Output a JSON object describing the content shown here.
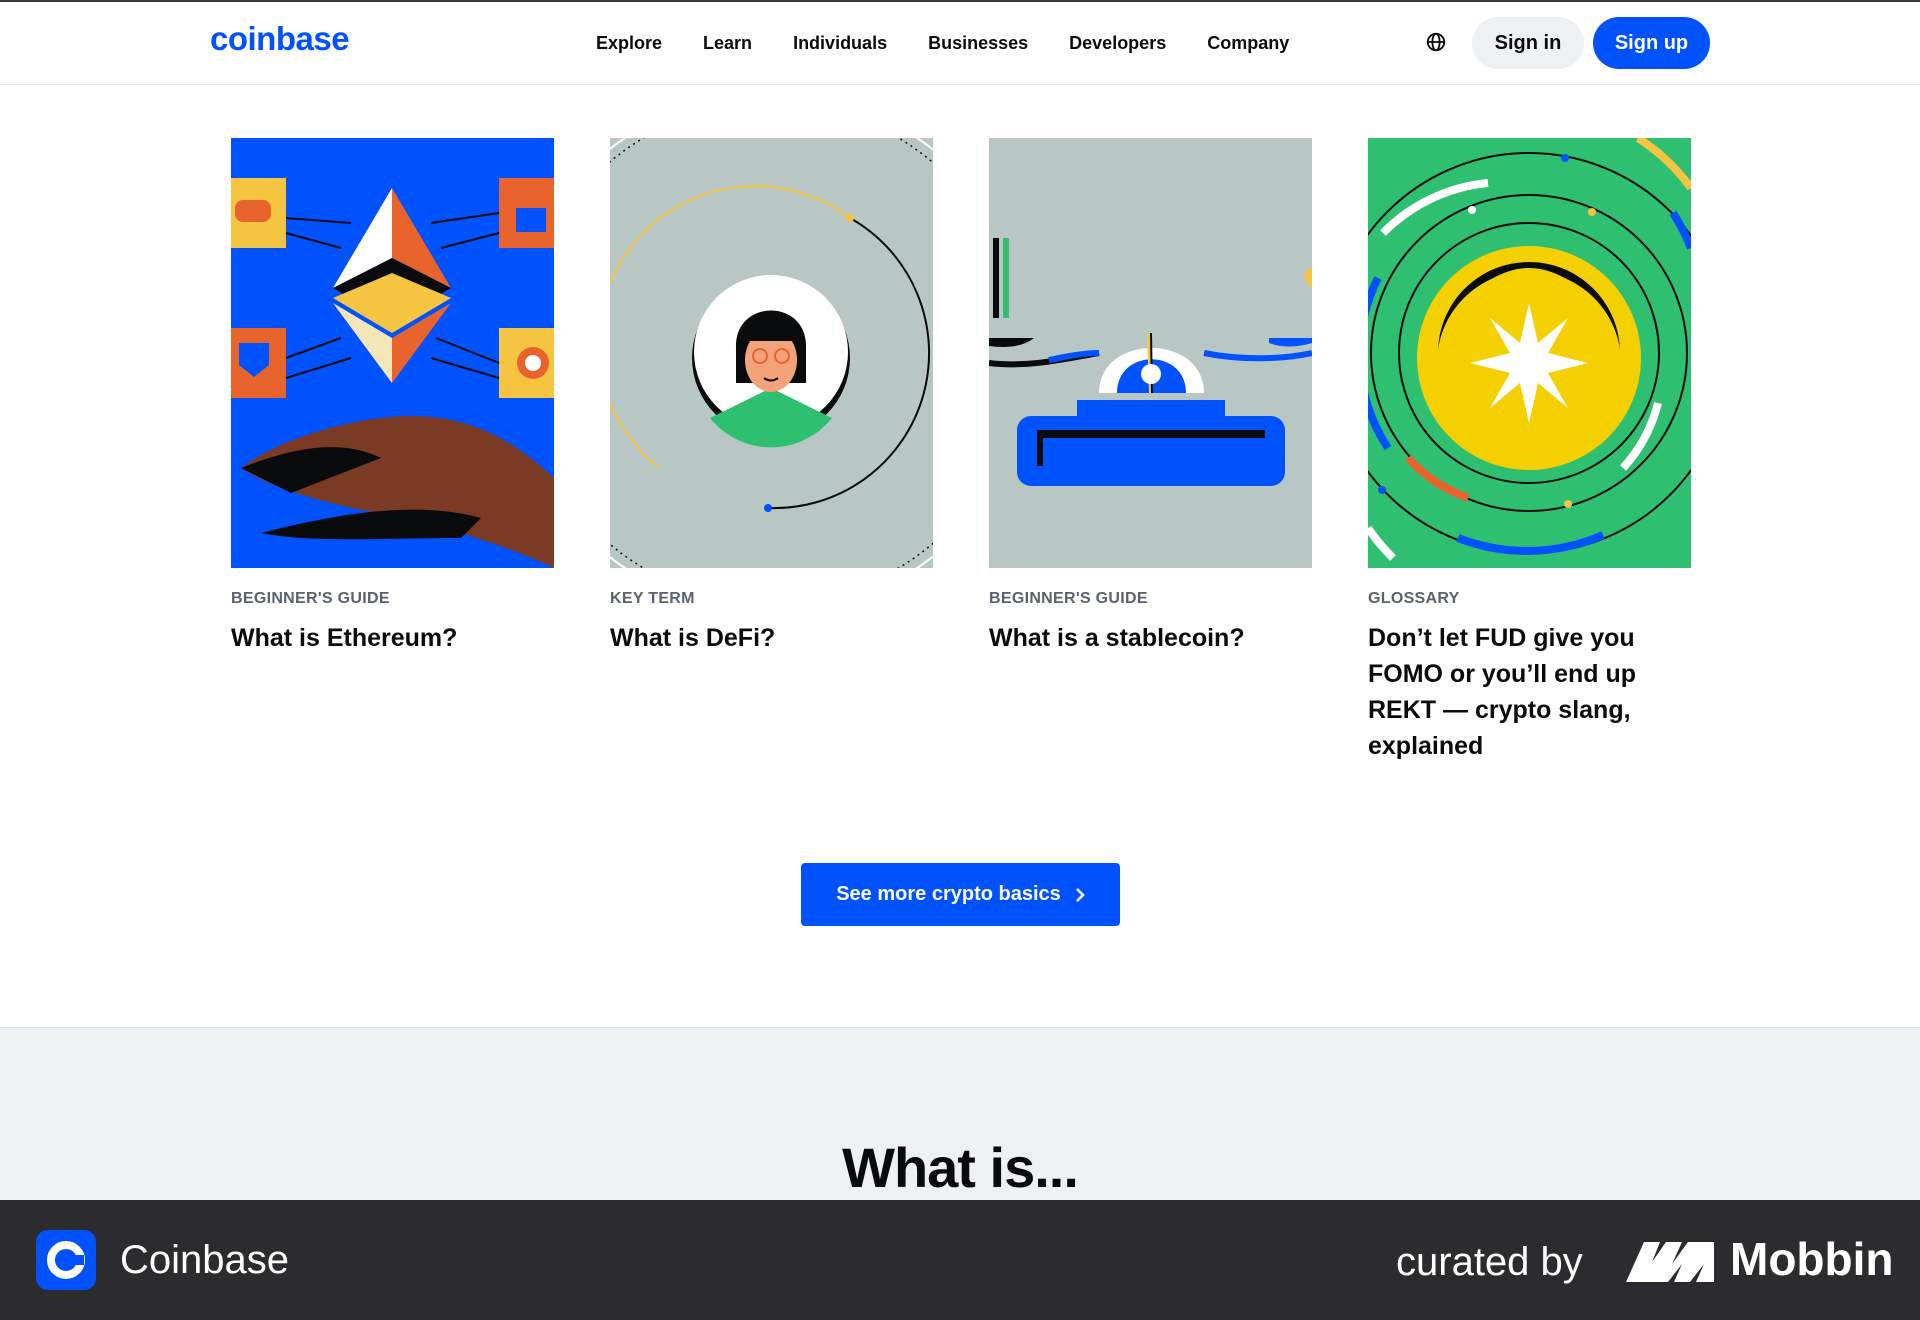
{
  "header": {
    "logo": "coinbase",
    "nav": [
      "Explore",
      "Learn",
      "Individuals",
      "Businesses",
      "Developers",
      "Company"
    ],
    "globe_icon": "globe-icon",
    "sign_in": "Sign in",
    "sign_up": "Sign up"
  },
  "cards": [
    {
      "category": "BEGINNER'S GUIDE",
      "title": "What is Ethereum?"
    },
    {
      "category": "KEY TERM",
      "title": "What is DeFi?"
    },
    {
      "category": "BEGINNER'S GUIDE",
      "title": "What is a stablecoin?"
    },
    {
      "category": "GLOSSARY",
      "title": "Don’t let FUD give you FOMO or you’ll end up REKT — crypto slang, explained"
    }
  ],
  "more_button": "See more crypto basics",
  "section_title": "What is...",
  "footer": {
    "app_name": "Coinbase",
    "curated_by": "curated by",
    "brand": "Mobbin"
  },
  "colors": {
    "brand_blue": "#0052ff",
    "text": "#0a0b0d",
    "muted": "#5b616e",
    "gray_bg": "#eef0f3",
    "footer_bg": "#2c2c2e"
  }
}
